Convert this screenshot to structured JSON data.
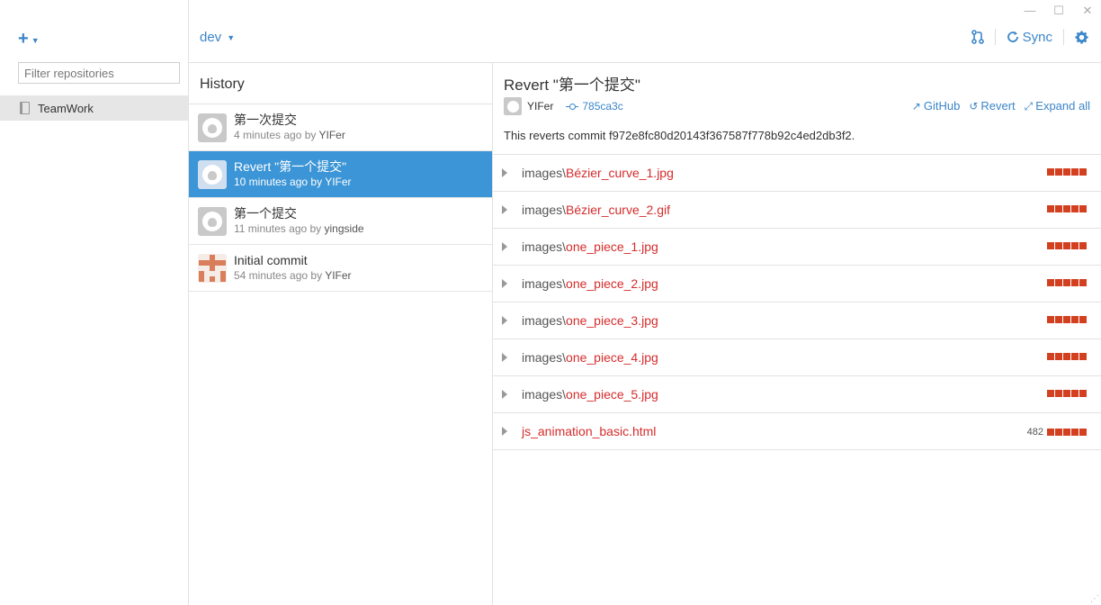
{
  "window": {
    "minimize": "—",
    "maximize": "☐",
    "close": "✕"
  },
  "sidebar": {
    "add_label": "+",
    "filter_placeholder": "Filter repositories",
    "repos": [
      {
        "label": "TeamWork"
      }
    ]
  },
  "topbar": {
    "branch": "dev",
    "sync_label": "Sync"
  },
  "history": {
    "title": "History",
    "commits": [
      {
        "message": "第一次提交",
        "time": "4 minutes ago by",
        "author": "YIFer"
      },
      {
        "message": "Revert \"第一个提交\"",
        "time": "10 minutes ago by",
        "author": "YIFer"
      },
      {
        "message": "第一个提交",
        "time": "11 minutes ago by",
        "author": "yingside"
      },
      {
        "message": "Initial commit",
        "time": "54 minutes ago by",
        "author": "YIFer"
      }
    ]
  },
  "detail": {
    "title": "Revert \"第一个提交\"",
    "author": "YIFer",
    "sha": "785ca3c",
    "actions": {
      "github": "GitHub",
      "revert": "Revert",
      "expand": "Expand all"
    },
    "description": "This reverts commit f972e8fc80d20143f367587f778b92c4ed2db3f2.",
    "files": [
      {
        "dir": "images\\",
        "name": "Bézier_curve_1.jpg",
        "count": ""
      },
      {
        "dir": "images\\",
        "name": "Bézier_curve_2.gif",
        "count": ""
      },
      {
        "dir": "images\\",
        "name": "one_piece_1.jpg",
        "count": ""
      },
      {
        "dir": "images\\",
        "name": "one_piece_2.jpg",
        "count": ""
      },
      {
        "dir": "images\\",
        "name": "one_piece_3.jpg",
        "count": ""
      },
      {
        "dir": "images\\",
        "name": "one_piece_4.jpg",
        "count": ""
      },
      {
        "dir": "images\\",
        "name": "one_piece_5.jpg",
        "count": ""
      },
      {
        "dir": "",
        "name": "js_animation_basic.html",
        "count": "482"
      }
    ]
  },
  "colors": {
    "accent": "#3b86c9",
    "selected": "#3c95d6",
    "deletion": "#d2401f",
    "filename": "#d62c2c"
  }
}
